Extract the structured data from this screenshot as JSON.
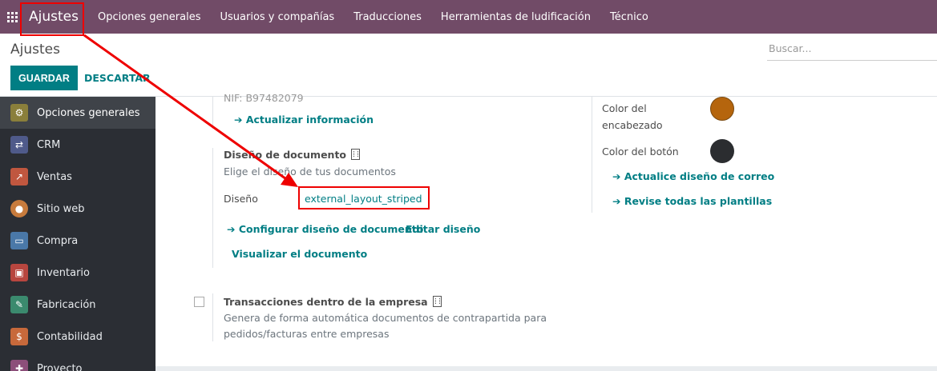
{
  "topnav": {
    "brand": "Ajustes",
    "menu": [
      "Opciones generales",
      "Usuarios y compañías",
      "Traducciones",
      "Herramientas de ludificación",
      "Técnico"
    ]
  },
  "control_panel": {
    "title": "Ajustes",
    "save_label": "GUARDAR",
    "discard_label": "DESCARTAR",
    "search_placeholder": "Buscar..."
  },
  "sidebar": {
    "items": [
      {
        "label": "Opciones generales",
        "icon": "gear-icon",
        "color": "#8a7f3b"
      },
      {
        "label": "CRM",
        "icon": "handshake-icon",
        "color": "#4f5a8a"
      },
      {
        "label": "Ventas",
        "icon": "chart-icon",
        "color": "#c0573f"
      },
      {
        "label": "Sitio web",
        "icon": "globe-icon",
        "color": "#c77b3d"
      },
      {
        "label": "Compra",
        "icon": "card-icon",
        "color": "#4a78a8"
      },
      {
        "label": "Inventario",
        "icon": "box-icon",
        "color": "#b8463f"
      },
      {
        "label": "Fabricación",
        "icon": "wrench-icon",
        "color": "#3b8a6e"
      },
      {
        "label": "Contabilidad",
        "icon": "dollar-icon",
        "color": "#c7693b"
      },
      {
        "label": "Proyecto",
        "icon": "puzzle-icon",
        "color": "#8c4f7a"
      }
    ]
  },
  "document": {
    "cut_text": "NIF: B97482079",
    "update_info_link": "Actualizar información",
    "layout_title": "Diseño de documento",
    "layout_desc": "Elige el diseño de tus documentos",
    "layout_field_label": "Diseño",
    "layout_value": "external_layout_striped",
    "configure_link": "Configurar diseño de documento",
    "edit_link": "Editar diseño",
    "preview_link": "Visualizar el documento"
  },
  "email_colors": {
    "header_color_label_1": "Color del",
    "header_color_label_2": "encabezado",
    "header_color": "#b5650d",
    "button_color_label": "Color del botón",
    "button_color": "#2b2d30",
    "update_email_link": "Actualice diseño de correo",
    "review_templates_link": "Revise todas las plantillas"
  },
  "intercompany": {
    "title": "Transacciones dentro de la empresa",
    "desc_line1": "Genera de forma automática documentos de contrapartida para",
    "desc_line2": "pedidos/facturas entre empresas"
  },
  "colors": {
    "brand": "#714B67",
    "accent": "#017E84",
    "annotation": "#e00000"
  }
}
